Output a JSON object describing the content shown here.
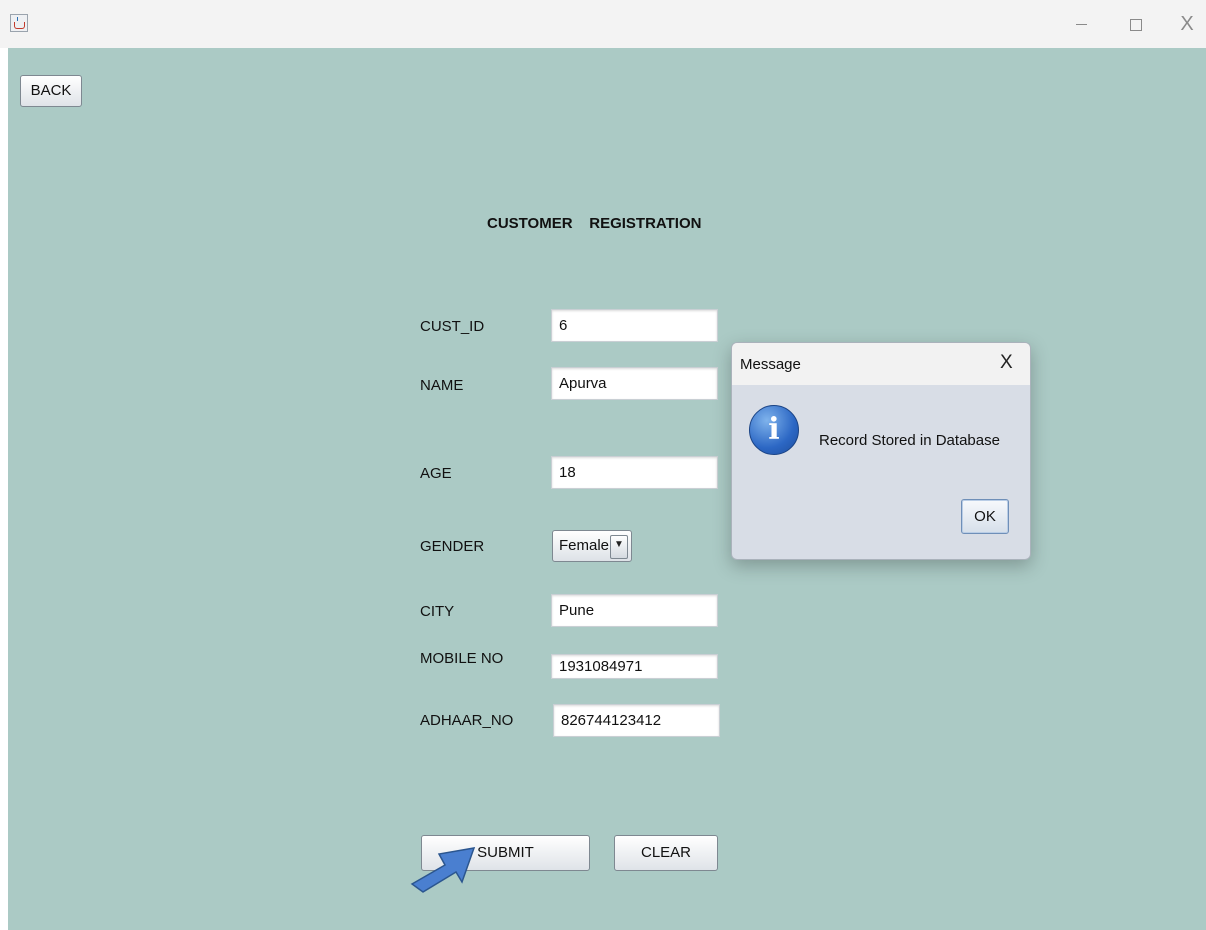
{
  "window": {
    "icon": "java-cup-icon",
    "controls": {
      "minimize": "minimize-icon",
      "maximize": "maximize-icon",
      "close": "X"
    }
  },
  "nav": {
    "back_label": "BACK"
  },
  "form": {
    "title": "CUSTOMER    REGISTRATION",
    "fields": {
      "cust_id": {
        "label": "CUST_ID",
        "value": "6"
      },
      "name": {
        "label": "NAME",
        "value": "Apurva"
      },
      "age": {
        "label": "AGE",
        "value": "18"
      },
      "gender": {
        "label": "GENDER",
        "value": "Female"
      },
      "city": {
        "label": "CITY",
        "value": "Pune"
      },
      "mobile_no": {
        "label": "MOBILE NO",
        "value": "1931084971"
      },
      "adhaar_no": {
        "label": "ADHAAR_NO",
        "value": "826744123412"
      }
    },
    "gender_arrow": "▼",
    "submit_label": "SUBMIT",
    "clear_label": "CLEAR"
  },
  "dialog": {
    "title": "Message",
    "close": "X",
    "icon_glyph": "i",
    "message": "Record Stored in Database",
    "ok_label": "OK"
  },
  "colors": {
    "background": "#abcac5",
    "dialog_body": "#d8dde6",
    "pointer_arrow": "#4a7fd0"
  }
}
